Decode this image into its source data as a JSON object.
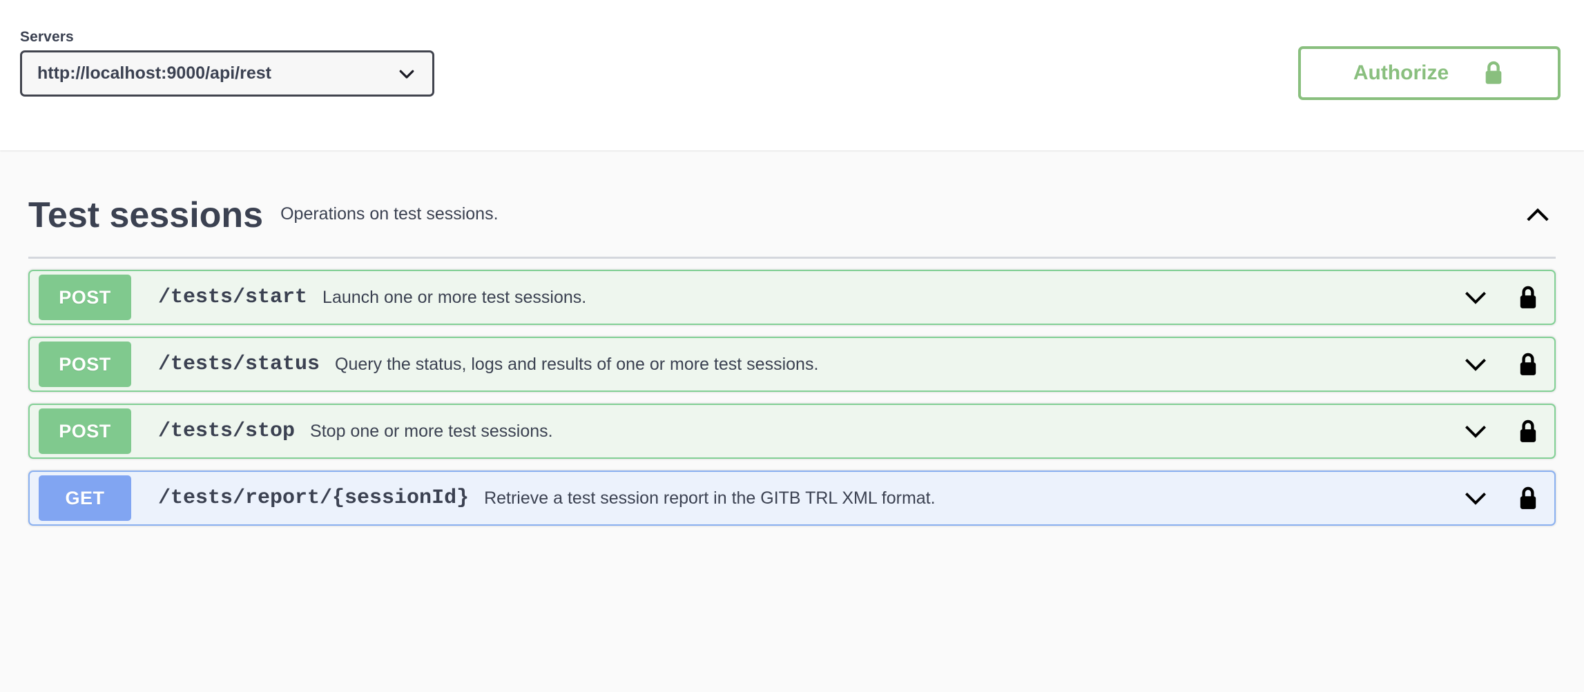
{
  "topbar": {
    "servers": {
      "label": "Servers",
      "selected": "http://localhost:9000/api/rest",
      "options": [
        "http://localhost:9000/api/rest"
      ],
      "chevron_icon": "chevron-down-icon"
    },
    "authorize": {
      "label": "Authorize",
      "icon": "lock-closed-icon",
      "color": "#89bf7e"
    }
  },
  "section": {
    "title": "Test sessions",
    "description": "Operations on test sessions.",
    "expanded": true,
    "toggle_icon": "chevron-up-icon"
  },
  "colors": {
    "post_badge": "#80c98e",
    "get_badge": "#81a5f2",
    "post_row_bg": "#eef6ee",
    "post_row_border": "#82d095",
    "get_row_bg": "#ecf2fc",
    "get_row_border": "#8ab0f0",
    "text": "#3b4151",
    "page_bg": "#fafafa"
  },
  "operations": [
    {
      "method": "POST",
      "path": "/tests/start",
      "description": "Launch one or more test sessions.",
      "expand_icon": "chevron-down-icon",
      "auth_icon": "lock-closed-icon"
    },
    {
      "method": "POST",
      "path": "/tests/status",
      "description": "Query the status, logs and results of one or more test sessions.",
      "expand_icon": "chevron-down-icon",
      "auth_icon": "lock-closed-icon"
    },
    {
      "method": "POST",
      "path": "/tests/stop",
      "description": "Stop one or more test sessions.",
      "expand_icon": "chevron-down-icon",
      "auth_icon": "lock-closed-icon"
    },
    {
      "method": "GET",
      "path": "/tests/report/{sessionId}",
      "description": "Retrieve a test session report in the GITB TRL XML format.",
      "expand_icon": "chevron-down-icon",
      "auth_icon": "lock-closed-icon"
    }
  ]
}
